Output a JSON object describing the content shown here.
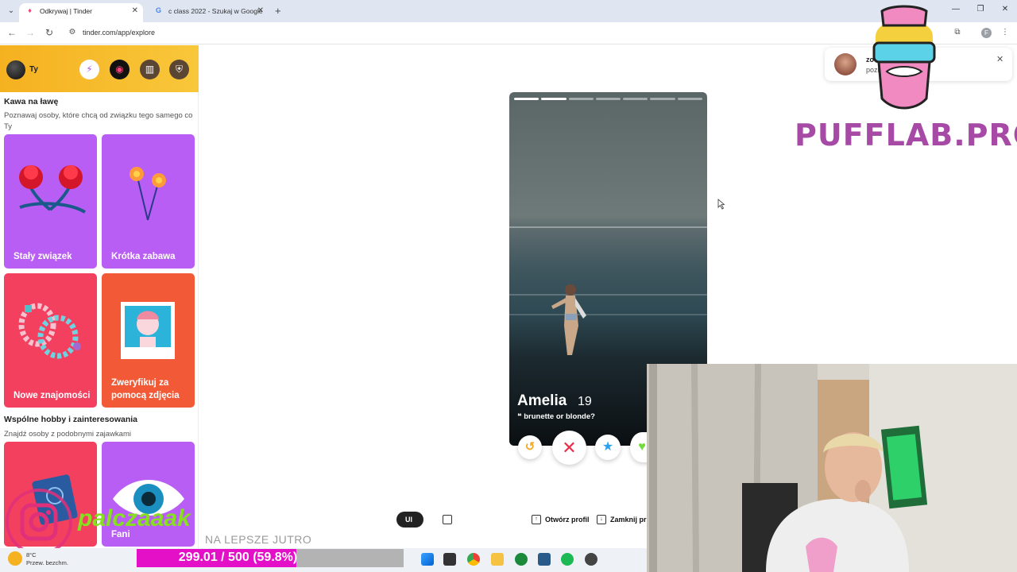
{
  "browser": {
    "tabs": [
      {
        "title": "Odkrywaj | Tinder",
        "active": true
      },
      {
        "title": "c class 2022 - Szukaj w Google",
        "active": false
      }
    ],
    "url": "tinder.com/app/explore"
  },
  "sidebar": {
    "user_label": "Ty",
    "section1": {
      "title": "Kawa na ławę",
      "subtitle": "Poznawaj osoby, które chcą od związku tego samego co Ty",
      "cards": [
        {
          "label": "Stały związek",
          "color": "#b95ef5"
        },
        {
          "label": "Krótka zabawa",
          "color": "#b95ef5"
        },
        {
          "label": "Nowe znajomości",
          "color": "#f3405f"
        },
        {
          "label": "Zweryfikuj za pomocą zdjęcia",
          "color": "#f25a37"
        }
      ]
    },
    "section2": {
      "title": "Wspólne hobby i zainteresowania",
      "subtitle": "Znajdź osoby z podobnymi zajawkami",
      "cards": [
        {
          "label": "",
          "color": "#f3405f"
        },
        {
          "label": "Fani",
          "color": "#b95ef5"
        }
      ]
    }
  },
  "toast": {
    "name": "zo",
    "message": "poznan"
  },
  "profile": {
    "name": "Amelia",
    "age": "19",
    "bio": "brunette or blonde?",
    "photo_count": 7,
    "current_photo": 2
  },
  "bottom_toolbar": {
    "items": [
      {
        "label": "Ul"
      },
      {
        "label": "Otwórz profil"
      },
      {
        "label": "Zamknij pr"
      }
    ]
  },
  "overlays": {
    "brand": "PUFFLAB.PRO",
    "slogan": "NA LEPSZE JUTRO",
    "streamer": "palczaaak",
    "goal_text": "299.01 / 500 (59.8%)",
    "goal_fraction": 0.598
  },
  "taskbar": {
    "weather_temp": "8°C",
    "weather_desc": "Przew. bezchm."
  }
}
